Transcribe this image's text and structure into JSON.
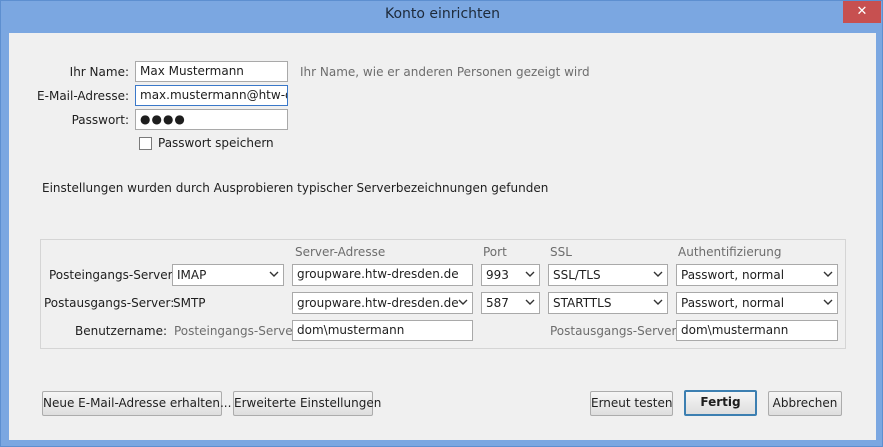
{
  "window": {
    "title": "Konto einrichten",
    "close_symbol": "✕"
  },
  "identity": {
    "name_label": "Ihr Name:",
    "name_value": "Max Mustermann",
    "name_hint": "Ihr Name, wie er anderen Personen gezeigt wird",
    "email_label": "E-Mail-Adresse:",
    "email_value": "max.mustermann@htw-dresden.de",
    "password_label": "Passwort:",
    "password_value": "●●●●",
    "remember_label": "Passwort speichern",
    "remember_checked": false
  },
  "status_text": "Einstellungen wurden durch Ausprobieren typischer Serverbezeichnungen gefunden",
  "server": {
    "headers": {
      "address": "Server-Adresse",
      "port": "Port",
      "ssl": "SSL",
      "auth": "Authentifizierung"
    },
    "incoming": {
      "label": "Posteingangs-Server:",
      "protocol": "IMAP",
      "address": "groupware.htw-dresden.de",
      "port": "993",
      "ssl": "SSL/TLS",
      "auth": "Passwort, normal"
    },
    "outgoing": {
      "label": "Postausgangs-Server:",
      "protocol": "SMTP",
      "address": "groupware.htw-dresden.de",
      "port": "587",
      "ssl": "STARTTLS",
      "auth": "Passwort, normal"
    },
    "username": {
      "label": "Benutzername:",
      "incoming_label": "Posteingangs-Server:",
      "incoming_value": "dom\\mustermann",
      "outgoing_label": "Postausgangs-Server:",
      "outgoing_value": "dom\\mustermann"
    }
  },
  "buttons": {
    "new_email": "Neue E-Mail-Adresse erhalten...",
    "advanced": "Erweiterte Einstellungen",
    "retest": "Erneut testen",
    "done": "Fertig",
    "cancel": "Abbrechen"
  }
}
